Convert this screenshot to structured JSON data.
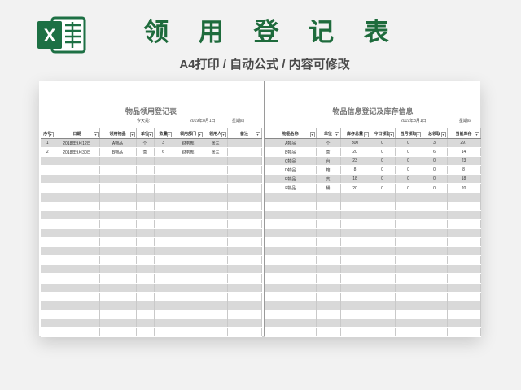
{
  "header": {
    "title": "领 用 登 记 表",
    "subtitle": "A4打印 / 自动公式 / 内容可修改"
  },
  "left": {
    "title": "物品领用登记表",
    "today_label": "今天是:",
    "date": "2019年8月1日",
    "weekday": "星期四",
    "columns": [
      "序号",
      "日期",
      "领用物品",
      "单位",
      "数量",
      "领用部门",
      "领用人",
      "备注"
    ],
    "rows": [
      [
        "1",
        "2018年9月12日",
        "A物品",
        "个",
        "3",
        "财务部",
        "张三",
        ""
      ],
      [
        "2",
        "2018年9月30日",
        "B物品",
        "盒",
        "6",
        "财务部",
        "张三",
        ""
      ]
    ]
  },
  "right": {
    "title": "物品信息登记及库存信息",
    "date": "2019年8月1日",
    "weekday": "星期四",
    "columns": [
      "物品名称",
      "单位",
      "库存总量",
      "今日领取",
      "当月领取",
      "总领取",
      "当前库存"
    ],
    "rows": [
      [
        "A物品",
        "个",
        "300",
        "0",
        "0",
        "3",
        "297"
      ],
      [
        "B物品",
        "盒",
        "20",
        "0",
        "0",
        "6",
        "14"
      ],
      [
        "C物品",
        "台",
        "23",
        "0",
        "0",
        "0",
        "23"
      ],
      [
        "D物品",
        "箱",
        "8",
        "0",
        "0",
        "0",
        "8"
      ],
      [
        "E物品",
        "支",
        "18",
        "0",
        "0",
        "0",
        "18"
      ],
      [
        "F物品",
        "桶",
        "20",
        "0",
        "0",
        "0",
        "20"
      ]
    ]
  },
  "colors": {
    "title_green": "#1e6b3c",
    "excel_green": "#1d7044",
    "stripe": "#d9d9d9"
  },
  "icons": {
    "logo": "excel-icon",
    "filter": "dropdown-arrow-icon"
  }
}
